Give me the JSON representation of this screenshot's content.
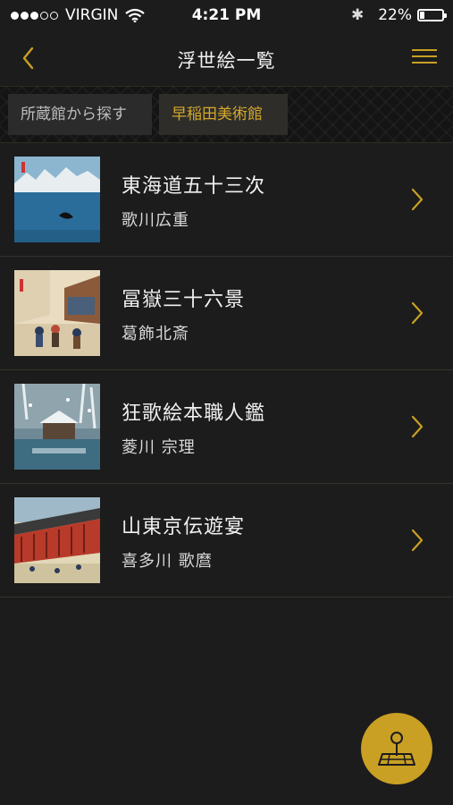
{
  "status_bar": {
    "carrier": "VIRGIN",
    "time": "4:21 PM",
    "battery_percent": "22%",
    "battery_level": 0.22,
    "signal_bars_filled": 3,
    "signal_bars_total": 5,
    "bluetooth_glyph": "✱"
  },
  "nav": {
    "title": "浮世絵一覧",
    "back_icon": "chevron-left-icon",
    "menu_icon": "hamburger-menu-icon"
  },
  "filters": {
    "search_by_museum_label": "所蔵館から探す",
    "selected_museum_label": "早稲田美術館"
  },
  "items": [
    {
      "title": "東海道五十三次",
      "artist": "歌川広重"
    },
    {
      "title": "冨嶽三十六景",
      "artist": "葛飾北斎"
    },
    {
      "title": "狂歌絵本職人鑑",
      "artist": "菱川 宗理"
    },
    {
      "title": "山東京伝遊宴",
      "artist": "喜多川 歌麿"
    }
  ],
  "fab": {
    "icon": "map-pin-icon"
  },
  "colors": {
    "accent": "#c9a024",
    "background": "#1c1c1c",
    "chip_bg": "#2b2b2b"
  }
}
